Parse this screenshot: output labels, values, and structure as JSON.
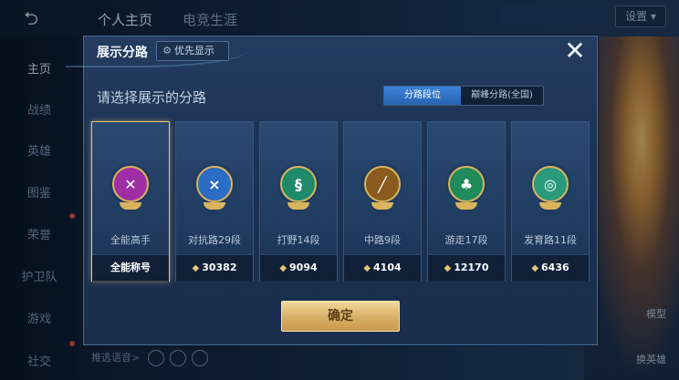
{
  "background": {
    "tabs": [
      {
        "label": "个人主页",
        "active": true
      },
      {
        "label": "电竞生涯",
        "active": false
      }
    ],
    "settings_label": "设置",
    "sidebar": [
      {
        "label": "主页",
        "active": true
      },
      {
        "label": "战绩",
        "active": false
      },
      {
        "label": "英雄",
        "active": false
      },
      {
        "label": "图鉴",
        "active": false
      },
      {
        "label": "荣誉",
        "active": false
      },
      {
        "label": "护卫队",
        "active": false
      },
      {
        "label": "游戏",
        "active": false
      },
      {
        "label": "社交",
        "active": false
      }
    ],
    "hero_labels": [
      "模型",
      "换英雄"
    ],
    "voice_label": "推选语音>"
  },
  "dialog": {
    "title": "展示分路",
    "priority_label": "优先显示",
    "subtitle": "请选择展示的分路",
    "segments": [
      {
        "label": "分路段位",
        "active": true
      },
      {
        "label": "巅峰分路(全国)",
        "active": false
      }
    ],
    "cards": [
      {
        "rank": "全能高手",
        "footer": "全能称号",
        "emblem_color": "#a02ea6",
        "icon": "crossed-swords-icon",
        "glyph": "✕",
        "selected": true
      },
      {
        "rank": "对抗路29段",
        "footer": "30382",
        "emblem_color": "#2b6cc4",
        "icon": "shield-x-icon",
        "glyph": "⨯",
        "selected": false
      },
      {
        "rank": "打野14段",
        "footer": "9094",
        "emblem_color": "#1f8a6a",
        "icon": "dragon-icon",
        "glyph": "§",
        "selected": false
      },
      {
        "rank": "中路9段",
        "footer": "4104",
        "emblem_color": "#8a5a1e",
        "icon": "slash-icon",
        "glyph": "╱",
        "selected": false
      },
      {
        "rank": "游走17段",
        "footer": "12170",
        "emblem_color": "#1f8a5a",
        "icon": "leaf-icon",
        "glyph": "♣",
        "selected": false
      },
      {
        "rank": "发育路11段",
        "footer": "6436",
        "emblem_color": "#2a9a7a",
        "icon": "target-icon",
        "glyph": "◎",
        "selected": false
      }
    ],
    "confirm_label": "确定"
  }
}
